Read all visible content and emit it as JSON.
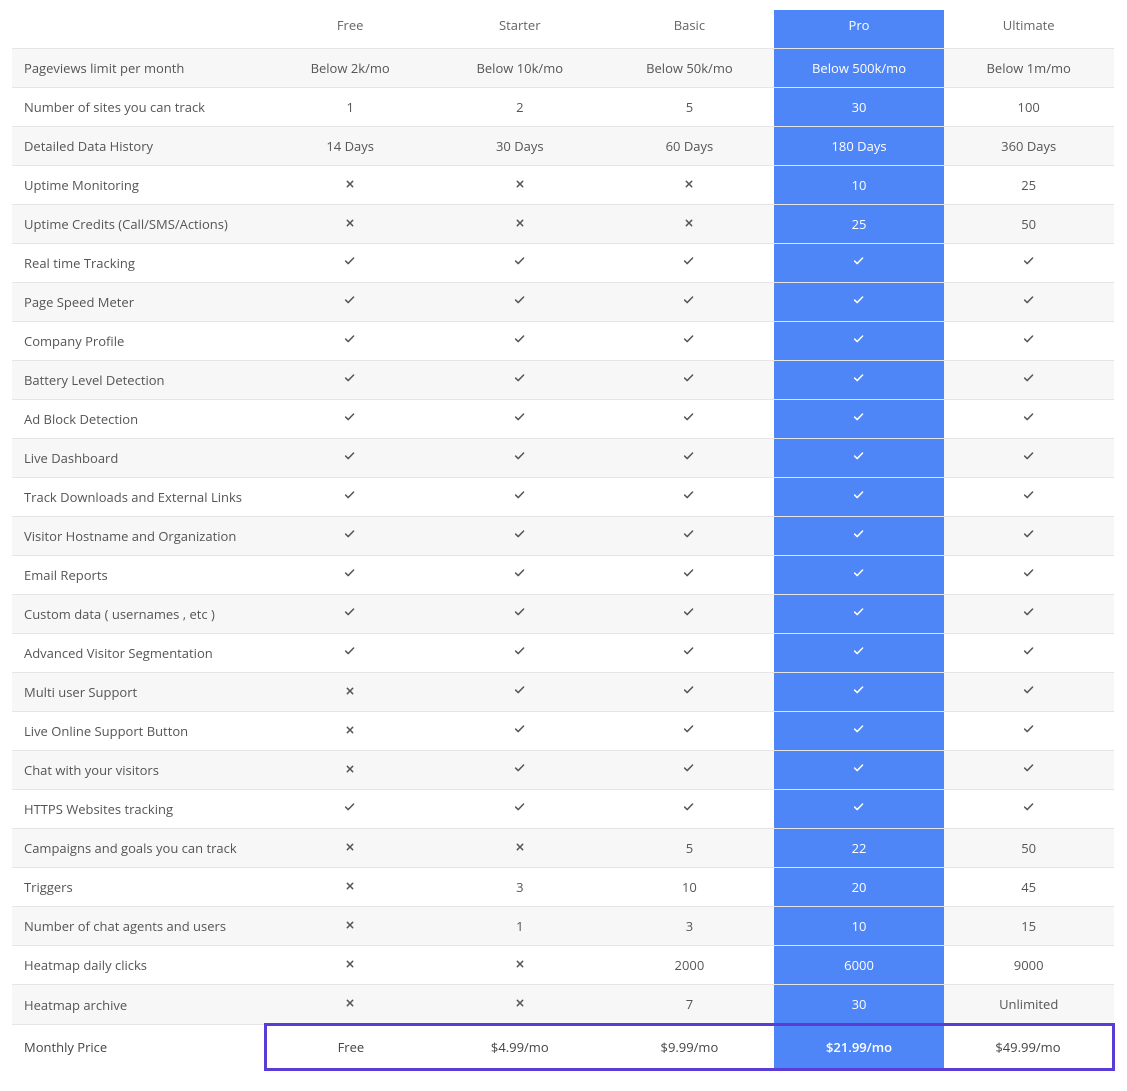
{
  "plans": [
    "Free",
    "Starter",
    "Basic",
    "Pro",
    "Ultimate"
  ],
  "featured_plan_index": 3,
  "features": [
    {
      "label": "Pageviews limit per month",
      "values": [
        "Below 2k/mo",
        "Below 10k/mo",
        "Below 50k/mo",
        "Below 500k/mo",
        "Below 1m/mo"
      ]
    },
    {
      "label": "Number of sites you can track",
      "values": [
        "1",
        "2",
        "5",
        "30",
        "100"
      ]
    },
    {
      "label": "Detailed Data History",
      "values": [
        "14 Days",
        "30 Days",
        "60 Days",
        "180 Days",
        "360 Days"
      ]
    },
    {
      "label": "Uptime Monitoring",
      "values": [
        "cross",
        "cross",
        "cross",
        "10",
        "25"
      ]
    },
    {
      "label": "Uptime Credits (Call/SMS/Actions)",
      "values": [
        "cross",
        "cross",
        "cross",
        "25",
        "50"
      ]
    },
    {
      "label": "Real time Tracking",
      "values": [
        "check",
        "check",
        "check",
        "check",
        "check"
      ]
    },
    {
      "label": "Page Speed Meter",
      "values": [
        "check",
        "check",
        "check",
        "check",
        "check"
      ]
    },
    {
      "label": "Company Profile",
      "values": [
        "check",
        "check",
        "check",
        "check",
        "check"
      ]
    },
    {
      "label": "Battery Level Detection",
      "values": [
        "check",
        "check",
        "check",
        "check",
        "check"
      ]
    },
    {
      "label": "Ad Block Detection",
      "values": [
        "check",
        "check",
        "check",
        "check",
        "check"
      ]
    },
    {
      "label": "Live Dashboard",
      "values": [
        "check",
        "check",
        "check",
        "check",
        "check"
      ]
    },
    {
      "label": "Track Downloads and External Links",
      "values": [
        "check",
        "check",
        "check",
        "check",
        "check"
      ]
    },
    {
      "label": "Visitor Hostname and Organization",
      "values": [
        "check",
        "check",
        "check",
        "check",
        "check"
      ]
    },
    {
      "label": "Email Reports",
      "values": [
        "check",
        "check",
        "check",
        "check",
        "check"
      ]
    },
    {
      "label": "Custom data ( usernames , etc )",
      "values": [
        "check",
        "check",
        "check",
        "check",
        "check"
      ]
    },
    {
      "label": "Advanced Visitor Segmentation",
      "values": [
        "check",
        "check",
        "check",
        "check",
        "check"
      ]
    },
    {
      "label": "Multi user Support",
      "values": [
        "cross",
        "check",
        "check",
        "check",
        "check"
      ]
    },
    {
      "label": "Live Online Support Button",
      "values": [
        "cross",
        "check",
        "check",
        "check",
        "check"
      ]
    },
    {
      "label": "Chat with your visitors",
      "values": [
        "cross",
        "check",
        "check",
        "check",
        "check"
      ]
    },
    {
      "label": "HTTPS Websites tracking",
      "values": [
        "check",
        "check",
        "check",
        "check",
        "check"
      ]
    },
    {
      "label": "Campaigns and goals you can track",
      "values": [
        "cross",
        "cross",
        "5",
        "22",
        "50"
      ]
    },
    {
      "label": "Triggers",
      "values": [
        "cross",
        "3",
        "10",
        "20",
        "45"
      ]
    },
    {
      "label": "Number of chat agents and users",
      "values": [
        "cross",
        "1",
        "3",
        "10",
        "15"
      ]
    },
    {
      "label": "Heatmap daily clicks",
      "values": [
        "cross",
        "cross",
        "2000",
        "6000",
        "9000"
      ]
    },
    {
      "label": "Heatmap archive",
      "values": [
        "cross",
        "cross",
        "7",
        "30",
        "Unlimited"
      ]
    }
  ],
  "price_row": {
    "label": "Monthly Price",
    "values": [
      "Free",
      "$4.99/mo",
      "$9.99/mo",
      "$21.99/mo",
      "$49.99/mo"
    ]
  }
}
